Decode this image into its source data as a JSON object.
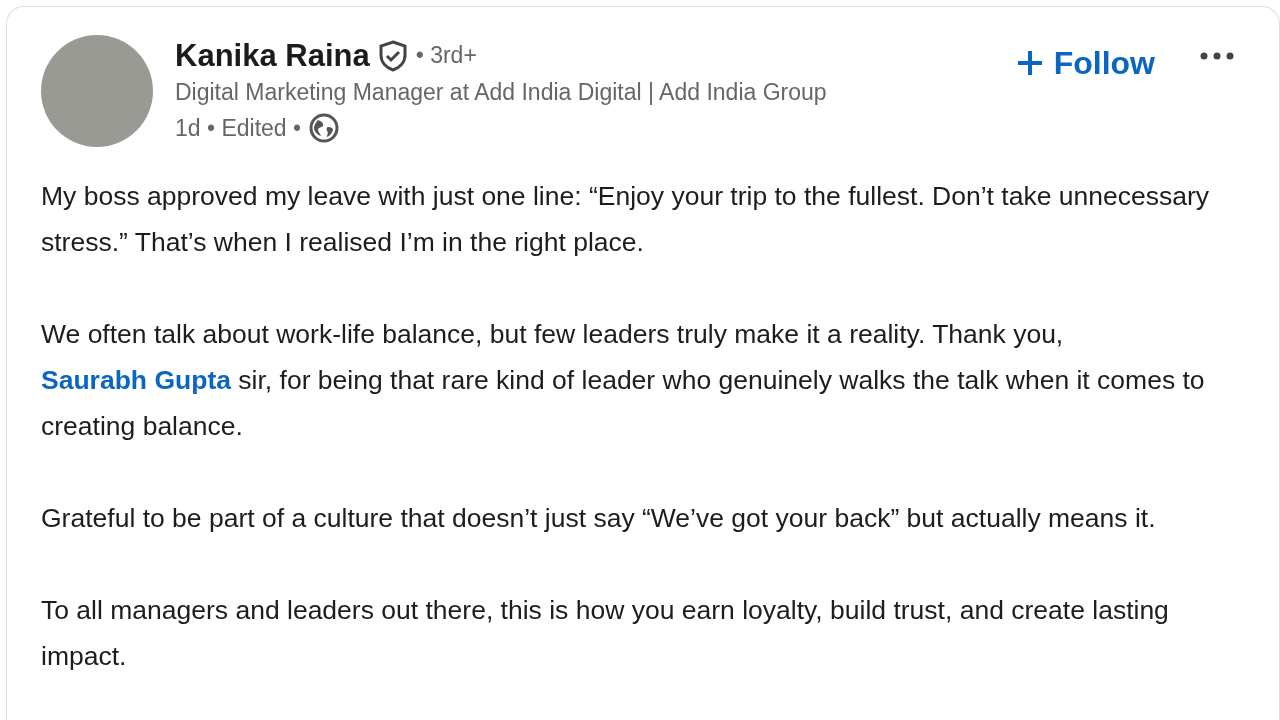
{
  "author": {
    "name": "Kanika Raina",
    "verified": true,
    "degree": "• 3rd+",
    "headline": "Digital Marketing Manager at Add India Digital | Add India Group",
    "time": "1d • Edited •"
  },
  "follow_button": {
    "label": "Follow"
  },
  "post": {
    "paragraphs": [
      [
        {
          "kind": "text",
          "text": "My boss approved my leave with just one line: “Enjoy your trip to the fullest. Don’t take unnecessary stress.” That’s when I realised I’m in the right place."
        }
      ],
      [
        {
          "kind": "text",
          "text": "We often talk about work-life balance, but few leaders truly make it a reality. Thank you, "
        },
        {
          "kind": "mention",
          "text": "Saurabh Gupta"
        },
        {
          "kind": "text",
          "text": " sir, for being that rare kind of leader who genuinely walks the talk when it comes to creating balance."
        }
      ],
      [
        {
          "kind": "text",
          "text": "Grateful to be part of a culture that doesn’t just say “We’ve got your back” but actually means it."
        }
      ],
      [
        {
          "kind": "text",
          "text": "To all managers and leaders out there, this is how you earn loyalty, build trust, and create lasting impact."
        }
      ]
    ]
  }
}
